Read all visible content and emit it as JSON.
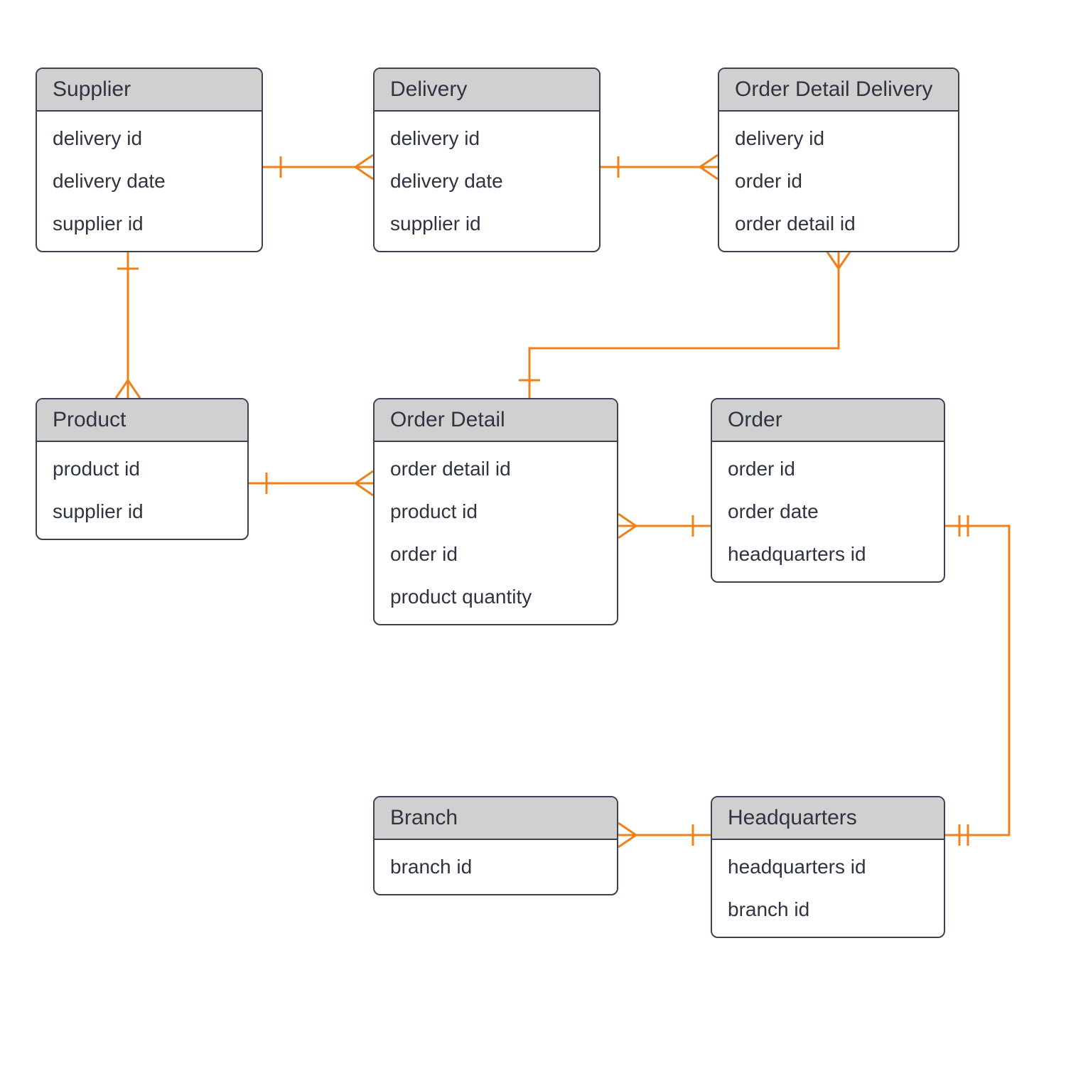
{
  "entities": {
    "supplier": {
      "title": "Supplier",
      "attrs": [
        "delivery id",
        "delivery date",
        "supplier id"
      ]
    },
    "delivery": {
      "title": "Delivery",
      "attrs": [
        "delivery id",
        "delivery date",
        "supplier id"
      ]
    },
    "orderDetailDelivery": {
      "title": "Order Detail Delivery",
      "attrs": [
        "delivery id",
        "order id",
        "order detail id"
      ]
    },
    "product": {
      "title": "Product",
      "attrs": [
        "product id",
        "supplier id"
      ]
    },
    "orderDetail": {
      "title": "Order Detail",
      "attrs": [
        "order detail id",
        "product id",
        "order id",
        "product quantity"
      ]
    },
    "order": {
      "title": "Order",
      "attrs": [
        "order id",
        "order date",
        "headquarters id"
      ]
    },
    "branch": {
      "title": "Branch",
      "attrs": [
        "branch id"
      ]
    },
    "headquarters": {
      "title": "Headquarters",
      "attrs": [
        "headquarters id",
        "branch id"
      ]
    }
  },
  "colors": {
    "connector": "#f08018",
    "entityBorder": "#3b4252",
    "entityHeader": "#d0d0d0"
  }
}
